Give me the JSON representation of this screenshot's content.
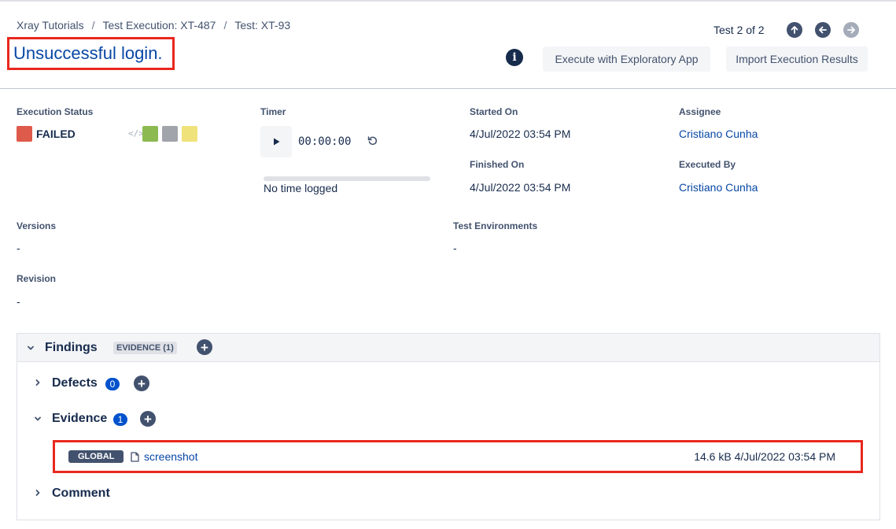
{
  "breadcrumb": [
    "Xray Tutorials",
    "Test Execution: XT-487",
    "Test: XT-93"
  ],
  "page_title": "Unsuccessful login.",
  "pager": {
    "text": "Test 2 of 2"
  },
  "buttons": {
    "execute_exploratory": "Execute with Exploratory App",
    "import_results": "Import Execution Results"
  },
  "execution_status": {
    "label": "Execution Status",
    "value": "FAILED",
    "color": "#de5a4a",
    "code_icon": "</>",
    "options": [
      {
        "name": "passed",
        "color": "#8cba51"
      },
      {
        "name": "todo",
        "color": "#a1a4ab"
      },
      {
        "name": "executing",
        "color": "#f0e27a"
      }
    ]
  },
  "timer": {
    "label": "Timer",
    "value": "00:00:00",
    "logged": "No time logged"
  },
  "started_on": {
    "label": "Started On",
    "value": "4/Jul/2022 03:54 PM"
  },
  "finished_on": {
    "label": "Finished On",
    "value": "4/Jul/2022 03:54 PM"
  },
  "assignee": {
    "label": "Assignee",
    "value": "Cristiano Cunha"
  },
  "executed_by": {
    "label": "Executed By",
    "value": "Cristiano Cunha"
  },
  "versions": {
    "label": "Versions",
    "value": "-"
  },
  "test_environments": {
    "label": "Test Environments",
    "value": "-"
  },
  "revision": {
    "label": "Revision",
    "value": "-"
  },
  "findings": {
    "title": "Findings",
    "lozenge": "EVIDENCE (1)",
    "defects": {
      "title": "Defects",
      "count": "0"
    },
    "evidence": {
      "title": "Evidence",
      "count": "1",
      "items": [
        {
          "scope": "GLOBAL",
          "name": "screenshot",
          "size": "14.6 kB",
          "date": "4/Jul/2022 03:54 PM"
        }
      ]
    },
    "comment": {
      "title": "Comment"
    }
  }
}
